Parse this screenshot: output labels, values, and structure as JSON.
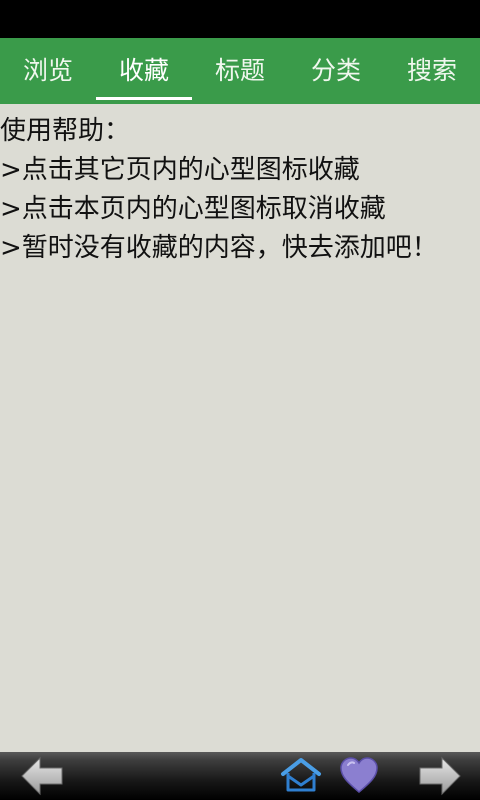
{
  "tabs": [
    {
      "label": "浏览",
      "active": false
    },
    {
      "label": "收藏",
      "active": true
    },
    {
      "label": "标题",
      "active": false
    },
    {
      "label": "分类",
      "active": false
    },
    {
      "label": "搜索",
      "active": false
    }
  ],
  "help": {
    "title": "使用帮助：",
    "lines": [
      ">点击其它页内的心型图标收藏",
      ">点击本页内的心型图标取消收藏",
      ">暂时没有收藏的内容，快去添加吧！"
    ]
  },
  "bottom_bar": {
    "icons": [
      "back-arrow-icon",
      "home-icon",
      "heart-icon",
      "forward-arrow-icon"
    ]
  },
  "colors": {
    "tab_bar": "#3a9b4a",
    "background": "#dcdcd4",
    "heart": "#8b7fd0"
  }
}
